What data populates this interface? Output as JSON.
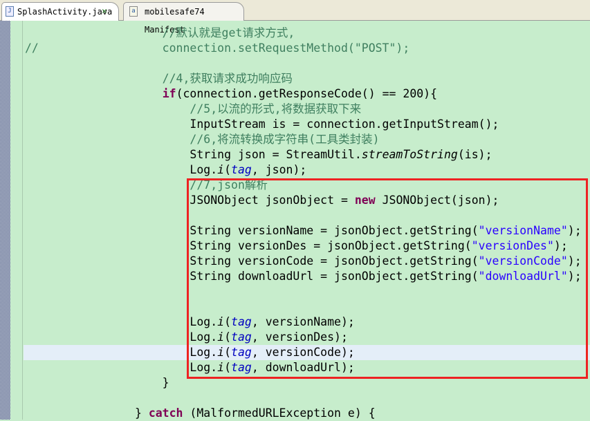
{
  "tabs": [
    {
      "label": "SplashActivity.java",
      "active": true,
      "icon": "java-file-icon"
    },
    {
      "label": "mobilesafe74 Manifest",
      "active": false,
      "icon": "manifest-file-icon"
    }
  ],
  "colors": {
    "background": "#c7edcc",
    "highlight_box": "#ee2222",
    "comment": "#3f7f5f",
    "keyword": "#7f0055",
    "string": "#2a00ff",
    "field": "#0000c0"
  },
  "current_line": 21,
  "lines": [
    [
      [
        "c",
        "                    //默认就是get请求方式,"
      ]
    ],
    [
      [
        "c",
        "//                  connection.setRequestMethod(\"POST\");"
      ]
    ],
    [],
    [
      [
        "c",
        "                    //4,获取请求成功响应码"
      ]
    ],
    [
      [
        "",
        "                    "
      ],
      [
        "k",
        "if"
      ],
      [
        "",
        "(connection.getResponseCode() == 200){"
      ]
    ],
    [
      [
        "c",
        "                        //5,以流的形式,将数据获取下来"
      ]
    ],
    [
      [
        "",
        "                        InputStream is = connection.getInputStream();"
      ]
    ],
    [
      [
        "c",
        "                        //6,将流转换成字符串(工具类封装)"
      ]
    ],
    [
      [
        "",
        "                        String json = StreamUtil."
      ],
      [
        "m",
        "streamToString"
      ],
      [
        "",
        "(is);"
      ]
    ],
    [
      [
        "",
        "                        Log."
      ],
      [
        "m",
        "i"
      ],
      [
        "",
        "("
      ],
      [
        "f",
        "tag"
      ],
      [
        "",
        ", json);"
      ]
    ],
    [
      [
        "c",
        "                        //7,json解析"
      ]
    ],
    [
      [
        "",
        "                        JSONObject jsonObject = "
      ],
      [
        "k",
        "new"
      ],
      [
        "",
        " JSONObject(json);"
      ]
    ],
    [],
    [
      [
        "",
        "                        String versionName = jsonObject.getString("
      ],
      [
        "s",
        "\"versionName\""
      ],
      [
        "",
        ");"
      ]
    ],
    [
      [
        "",
        "                        String versionDes = jsonObject.getString("
      ],
      [
        "s",
        "\"versionDes\""
      ],
      [
        "",
        ");"
      ]
    ],
    [
      [
        "",
        "                        String versionCode = jsonObject.getString("
      ],
      [
        "s",
        "\"versionCode\""
      ],
      [
        "",
        ");"
      ]
    ],
    [
      [
        "",
        "                        String downloadUrl = jsonObject.getString("
      ],
      [
        "s",
        "\"downloadUrl\""
      ],
      [
        "",
        ");"
      ]
    ],
    [],
    [],
    [
      [
        "",
        "                        Log."
      ],
      [
        "m",
        "i"
      ],
      [
        "",
        "("
      ],
      [
        "f",
        "tag"
      ],
      [
        "",
        ", versionName);"
      ]
    ],
    [
      [
        "",
        "                        Log."
      ],
      [
        "m",
        "i"
      ],
      [
        "",
        "("
      ],
      [
        "f",
        "tag"
      ],
      [
        "",
        ", versionDes);"
      ]
    ],
    [
      [
        "",
        "                        Log."
      ],
      [
        "m",
        "i"
      ],
      [
        "",
        "("
      ],
      [
        "f",
        "tag"
      ],
      [
        "",
        ", versionCode);"
      ]
    ],
    [
      [
        "",
        "                        Log."
      ],
      [
        "m",
        "i"
      ],
      [
        "",
        "("
      ],
      [
        "f",
        "tag"
      ],
      [
        "",
        ", downloadUrl);"
      ]
    ],
    [
      [
        "",
        "                    }"
      ]
    ],
    [],
    [
      [
        "",
        "                } "
      ],
      [
        "k",
        "catch"
      ],
      [
        "",
        " (MalformedURLException e) {"
      ]
    ]
  ]
}
